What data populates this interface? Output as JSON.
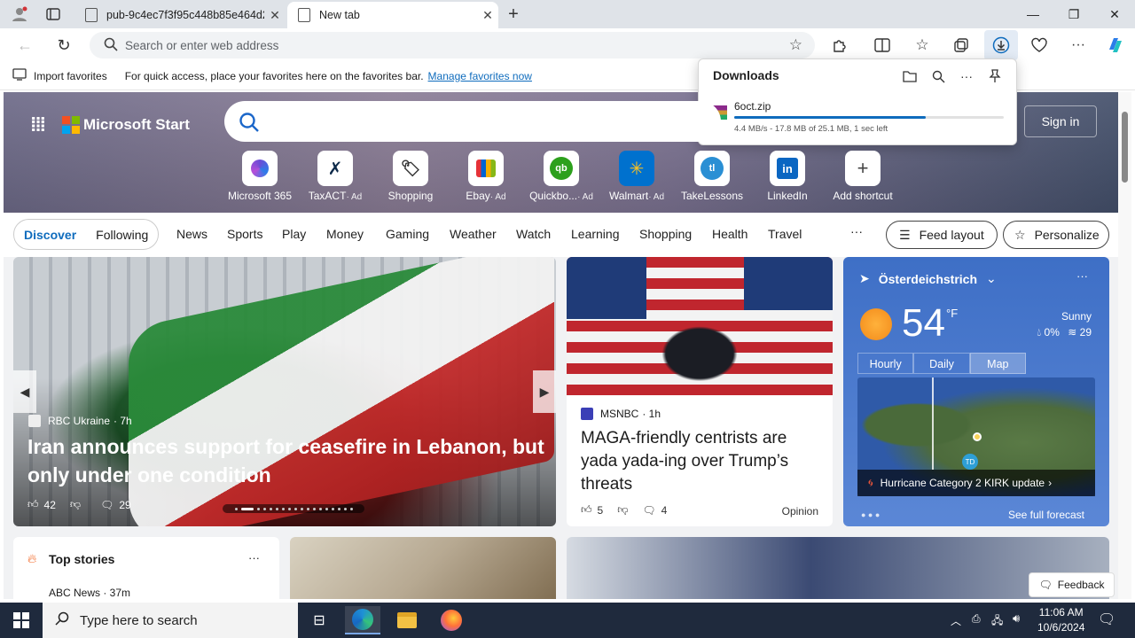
{
  "browser": {
    "tabs": [
      {
        "label": "pub-9c4ec7f3f95c448b85e464d2b"
      },
      {
        "label": "New tab"
      }
    ],
    "address_placeholder": "Search or enter web address"
  },
  "favorites_bar": {
    "import_label": "Import favorites",
    "message": "For quick access, place your favorites here on the favorites bar.",
    "manage_link": "Manage favorites now"
  },
  "downloads": {
    "title": "Downloads",
    "file_name": "6oct.zip",
    "progress_fraction": 0.71,
    "status": "4.4 MB/s - 17.8 MB of 25.1 MB, 1 sec left",
    "accent": "#0f6cbd"
  },
  "msn": {
    "brand": "Microsoft Start",
    "sign_in": "Sign in",
    "shortcuts": [
      {
        "label": "Microsoft 365",
        "ad": "",
        "icon": "m365-icon"
      },
      {
        "label": "TaxACT",
        "ad": "· Ad",
        "icon": "taxact-icon"
      },
      {
        "label": "Shopping",
        "ad": "",
        "icon": "tag-icon"
      },
      {
        "label": "Ebay",
        "ad": "· Ad",
        "icon": "ebay-icon"
      },
      {
        "label": "Quickbo...",
        "ad": "· Ad",
        "icon": "quickbooks-icon"
      },
      {
        "label": "Walmart",
        "ad": "· Ad",
        "icon": "walmart-icon"
      },
      {
        "label": "TakeLessons",
        "ad": "",
        "icon": "takelessons-icon"
      },
      {
        "label": "LinkedIn",
        "ad": "",
        "icon": "linkedin-icon"
      },
      {
        "label": "Add shortcut",
        "ad": "",
        "icon": "plus-icon"
      }
    ],
    "nav": {
      "discover": "Discover",
      "following": "Following",
      "links": [
        "News",
        "Sports",
        "Play",
        "Money",
        "Gaming",
        "Weather",
        "Watch",
        "Learning",
        "Shopping",
        "Health",
        "Travel"
      ],
      "more": "···",
      "feed_layout": "Feed layout",
      "personalize": "Personalize"
    },
    "main_story": {
      "source": "RBC Ukraine",
      "age": "· 7h",
      "headline": "Iran announces support for ceasefire in Lebanon, but only under one condition",
      "likes": "42",
      "comments": "29"
    },
    "second_story": {
      "source": "MSNBC",
      "age": "· 1h",
      "headline": "MAGA-friendly centrists are yada yada-ing over Trump’s threats",
      "likes": "5",
      "comments": "4",
      "tag": "Opinion"
    },
    "weather": {
      "location": "Österdeichstrich",
      "temp": "54",
      "unit": "°F",
      "condition": "Sunny",
      "precip": "0%",
      "wind": "29",
      "tabs": [
        "Hourly",
        "Daily",
        "Map"
      ],
      "alert": "Hurricane Category 2 KIRK update",
      "forecast_link": "See full forecast"
    },
    "top_stories": {
      "title": "Top stories",
      "first_source": "ABC News · 37m"
    },
    "feedback": "Feedback"
  },
  "taskbar": {
    "search_placeholder": "Type here to search",
    "time": "11:06 AM",
    "date": "10/6/2024"
  }
}
